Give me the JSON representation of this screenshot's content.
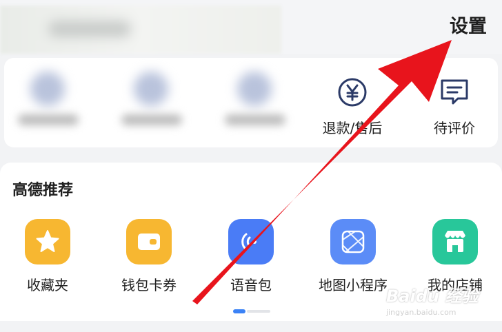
{
  "header": {
    "settings_label": "设置"
  },
  "orders": {
    "items": [
      {
        "label": "退款/售后",
        "icon": "refund-yuan-icon"
      },
      {
        "label": "待评价",
        "icon": "comment-icon"
      }
    ]
  },
  "recommend": {
    "title": "高德推荐",
    "apps": [
      {
        "label": "收藏夹",
        "icon": "star-icon",
        "color": "#f7b731"
      },
      {
        "label": "钱包卡券",
        "icon": "wallet-icon",
        "color": "#f7b731"
      },
      {
        "label": "语音包",
        "icon": "voice-icon",
        "color": "#4a7cf6"
      },
      {
        "label": "地图小程序",
        "icon": "map-mini-program-icon",
        "color": "#5b8cf7"
      },
      {
        "label": "我的店铺",
        "icon": "store-icon",
        "color": "#28c79a"
      }
    ],
    "page_indicator": {
      "active": 1,
      "total": 2
    }
  },
  "overlay": {
    "arrow_color": "#e8141c"
  },
  "watermark": {
    "brand": "Baidu 经验",
    "url": "jingyan.baidu.com"
  }
}
